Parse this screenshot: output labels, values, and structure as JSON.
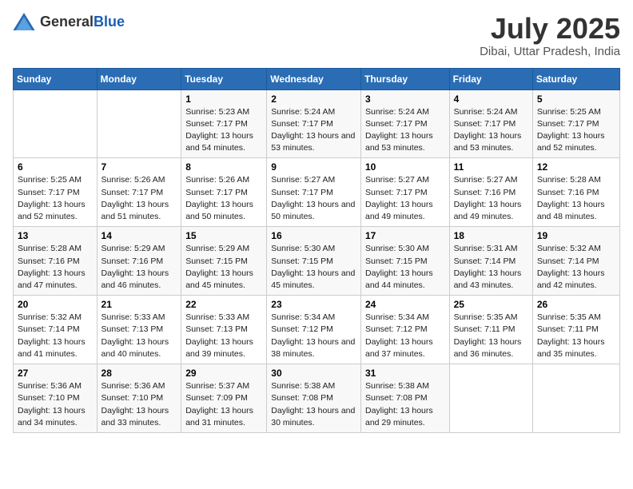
{
  "logo": {
    "general": "General",
    "blue": "Blue"
  },
  "title": "July 2025",
  "location": "Dibai, Uttar Pradesh, India",
  "days_of_week": [
    "Sunday",
    "Monday",
    "Tuesday",
    "Wednesday",
    "Thursday",
    "Friday",
    "Saturday"
  ],
  "weeks": [
    [
      {
        "day": "",
        "sunrise": "",
        "sunset": "",
        "daylight": ""
      },
      {
        "day": "",
        "sunrise": "",
        "sunset": "",
        "daylight": ""
      },
      {
        "day": "1",
        "sunrise": "Sunrise: 5:23 AM",
        "sunset": "Sunset: 7:17 PM",
        "daylight": "Daylight: 13 hours and 54 minutes."
      },
      {
        "day": "2",
        "sunrise": "Sunrise: 5:24 AM",
        "sunset": "Sunset: 7:17 PM",
        "daylight": "Daylight: 13 hours and 53 minutes."
      },
      {
        "day": "3",
        "sunrise": "Sunrise: 5:24 AM",
        "sunset": "Sunset: 7:17 PM",
        "daylight": "Daylight: 13 hours and 53 minutes."
      },
      {
        "day": "4",
        "sunrise": "Sunrise: 5:24 AM",
        "sunset": "Sunset: 7:17 PM",
        "daylight": "Daylight: 13 hours and 53 minutes."
      },
      {
        "day": "5",
        "sunrise": "Sunrise: 5:25 AM",
        "sunset": "Sunset: 7:17 PM",
        "daylight": "Daylight: 13 hours and 52 minutes."
      }
    ],
    [
      {
        "day": "6",
        "sunrise": "Sunrise: 5:25 AM",
        "sunset": "Sunset: 7:17 PM",
        "daylight": "Daylight: 13 hours and 52 minutes."
      },
      {
        "day": "7",
        "sunrise": "Sunrise: 5:26 AM",
        "sunset": "Sunset: 7:17 PM",
        "daylight": "Daylight: 13 hours and 51 minutes."
      },
      {
        "day": "8",
        "sunrise": "Sunrise: 5:26 AM",
        "sunset": "Sunset: 7:17 PM",
        "daylight": "Daylight: 13 hours and 50 minutes."
      },
      {
        "day": "9",
        "sunrise": "Sunrise: 5:27 AM",
        "sunset": "Sunset: 7:17 PM",
        "daylight": "Daylight: 13 hours and 50 minutes."
      },
      {
        "day": "10",
        "sunrise": "Sunrise: 5:27 AM",
        "sunset": "Sunset: 7:17 PM",
        "daylight": "Daylight: 13 hours and 49 minutes."
      },
      {
        "day": "11",
        "sunrise": "Sunrise: 5:27 AM",
        "sunset": "Sunset: 7:16 PM",
        "daylight": "Daylight: 13 hours and 49 minutes."
      },
      {
        "day": "12",
        "sunrise": "Sunrise: 5:28 AM",
        "sunset": "Sunset: 7:16 PM",
        "daylight": "Daylight: 13 hours and 48 minutes."
      }
    ],
    [
      {
        "day": "13",
        "sunrise": "Sunrise: 5:28 AM",
        "sunset": "Sunset: 7:16 PM",
        "daylight": "Daylight: 13 hours and 47 minutes."
      },
      {
        "day": "14",
        "sunrise": "Sunrise: 5:29 AM",
        "sunset": "Sunset: 7:16 PM",
        "daylight": "Daylight: 13 hours and 46 minutes."
      },
      {
        "day": "15",
        "sunrise": "Sunrise: 5:29 AM",
        "sunset": "Sunset: 7:15 PM",
        "daylight": "Daylight: 13 hours and 45 minutes."
      },
      {
        "day": "16",
        "sunrise": "Sunrise: 5:30 AM",
        "sunset": "Sunset: 7:15 PM",
        "daylight": "Daylight: 13 hours and 45 minutes."
      },
      {
        "day": "17",
        "sunrise": "Sunrise: 5:30 AM",
        "sunset": "Sunset: 7:15 PM",
        "daylight": "Daylight: 13 hours and 44 minutes."
      },
      {
        "day": "18",
        "sunrise": "Sunrise: 5:31 AM",
        "sunset": "Sunset: 7:14 PM",
        "daylight": "Daylight: 13 hours and 43 minutes."
      },
      {
        "day": "19",
        "sunrise": "Sunrise: 5:32 AM",
        "sunset": "Sunset: 7:14 PM",
        "daylight": "Daylight: 13 hours and 42 minutes."
      }
    ],
    [
      {
        "day": "20",
        "sunrise": "Sunrise: 5:32 AM",
        "sunset": "Sunset: 7:14 PM",
        "daylight": "Daylight: 13 hours and 41 minutes."
      },
      {
        "day": "21",
        "sunrise": "Sunrise: 5:33 AM",
        "sunset": "Sunset: 7:13 PM",
        "daylight": "Daylight: 13 hours and 40 minutes."
      },
      {
        "day": "22",
        "sunrise": "Sunrise: 5:33 AM",
        "sunset": "Sunset: 7:13 PM",
        "daylight": "Daylight: 13 hours and 39 minutes."
      },
      {
        "day": "23",
        "sunrise": "Sunrise: 5:34 AM",
        "sunset": "Sunset: 7:12 PM",
        "daylight": "Daylight: 13 hours and 38 minutes."
      },
      {
        "day": "24",
        "sunrise": "Sunrise: 5:34 AM",
        "sunset": "Sunset: 7:12 PM",
        "daylight": "Daylight: 13 hours and 37 minutes."
      },
      {
        "day": "25",
        "sunrise": "Sunrise: 5:35 AM",
        "sunset": "Sunset: 7:11 PM",
        "daylight": "Daylight: 13 hours and 36 minutes."
      },
      {
        "day": "26",
        "sunrise": "Sunrise: 5:35 AM",
        "sunset": "Sunset: 7:11 PM",
        "daylight": "Daylight: 13 hours and 35 minutes."
      }
    ],
    [
      {
        "day": "27",
        "sunrise": "Sunrise: 5:36 AM",
        "sunset": "Sunset: 7:10 PM",
        "daylight": "Daylight: 13 hours and 34 minutes."
      },
      {
        "day": "28",
        "sunrise": "Sunrise: 5:36 AM",
        "sunset": "Sunset: 7:10 PM",
        "daylight": "Daylight: 13 hours and 33 minutes."
      },
      {
        "day": "29",
        "sunrise": "Sunrise: 5:37 AM",
        "sunset": "Sunset: 7:09 PM",
        "daylight": "Daylight: 13 hours and 31 minutes."
      },
      {
        "day": "30",
        "sunrise": "Sunrise: 5:38 AM",
        "sunset": "Sunset: 7:08 PM",
        "daylight": "Daylight: 13 hours and 30 minutes."
      },
      {
        "day": "31",
        "sunrise": "Sunrise: 5:38 AM",
        "sunset": "Sunset: 7:08 PM",
        "daylight": "Daylight: 13 hours and 29 minutes."
      },
      {
        "day": "",
        "sunrise": "",
        "sunset": "",
        "daylight": ""
      },
      {
        "day": "",
        "sunrise": "",
        "sunset": "",
        "daylight": ""
      }
    ]
  ]
}
